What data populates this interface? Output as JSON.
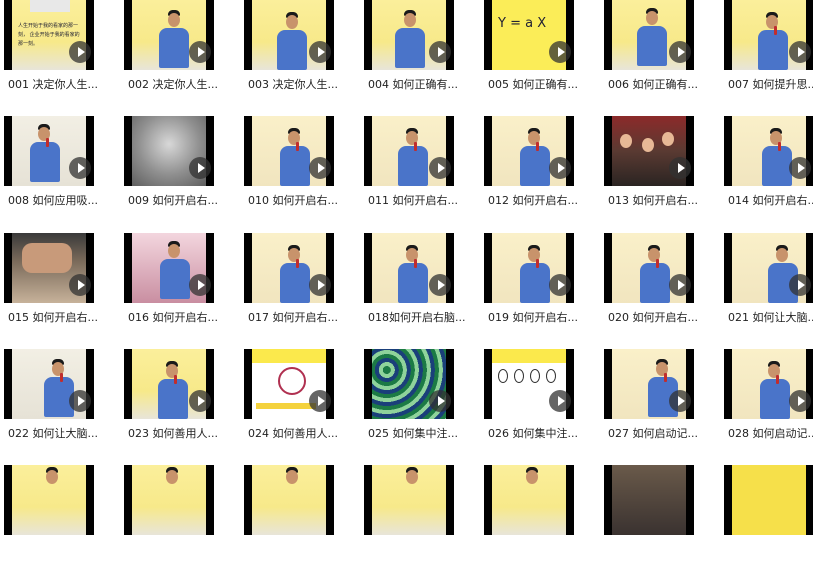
{
  "items": [
    {
      "label": "001 决定你人生..."
    },
    {
      "label": "002 决定你人生..."
    },
    {
      "label": "003 决定你人生..."
    },
    {
      "label": "004 如何正确有..."
    },
    {
      "label": "005 如何正确有..."
    },
    {
      "label": "006 如何正确有..."
    },
    {
      "label": "007 如何提升思..."
    },
    {
      "label": "008 如何应用吸..."
    },
    {
      "label": "009 如何开启右..."
    },
    {
      "label": "010 如何开启右..."
    },
    {
      "label": "011 如何开启右..."
    },
    {
      "label": "012 如何开启右..."
    },
    {
      "label": "013 如何开启右..."
    },
    {
      "label": "014 如何开启右..."
    },
    {
      "label": "015 如何开启右..."
    },
    {
      "label": "016 如何开启右..."
    },
    {
      "label": "017 如何开启右..."
    },
    {
      "label": "018如何开启右脑..."
    },
    {
      "label": "019 如何开启右..."
    },
    {
      "label": "020 如何开启右..."
    },
    {
      "label": "021 如何让大脑..."
    },
    {
      "label": "022 如何让大脑..."
    },
    {
      "label": "023 如何善用人..."
    },
    {
      "label": "024 如何善用人..."
    },
    {
      "label": "025 如何集中注..."
    },
    {
      "label": "026 如何集中注..."
    },
    {
      "label": "027 如何启动记..."
    },
    {
      "label": "028 如何启动记..."
    },
    {
      "label": ""
    },
    {
      "label": ""
    },
    {
      "label": ""
    },
    {
      "label": ""
    },
    {
      "label": ""
    },
    {
      "label": ""
    },
    {
      "label": ""
    }
  ],
  "thumb_text": {
    "t001": "人生开始于我的看家的那一刻，\n企业开始于我的看家的那一刻。",
    "t005": "Y = a X"
  },
  "colors": {
    "shirt": "#4a74c9",
    "yellow": "#f7e98a",
    "play_overlay": "#323232"
  }
}
